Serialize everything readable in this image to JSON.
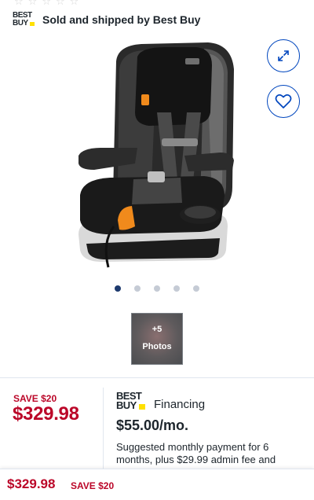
{
  "rating": {
    "stars": [
      "☆",
      "☆",
      "☆",
      "☆",
      "☆"
    ]
  },
  "seller": {
    "logo_line1": "BEST",
    "logo_line2": "BUY",
    "text": "Sold and shipped by Best Buy"
  },
  "gallery": {
    "expand_icon": "expand-icon",
    "wishlist_icon": "heart-icon",
    "dots_total": 5,
    "dots_active": 0,
    "thumb_count": "+5",
    "thumb_label": "Photos"
  },
  "pricing": {
    "save_label": "SAVE $20",
    "price": "$329.98"
  },
  "financing": {
    "logo_line1": "BEST",
    "logo_line2": "BUY",
    "title": "Financing",
    "amount": "$55.00/mo.",
    "description": "Suggested monthly payment for 6 months, plus $29.99 admin fee and"
  },
  "sticky_bar": {
    "price": "$329.98",
    "save_label": "SAVE $20"
  },
  "colors": {
    "sale_red": "#bb0628",
    "accent_blue": "#0046be",
    "logo_yellow": "#ffe000"
  }
}
